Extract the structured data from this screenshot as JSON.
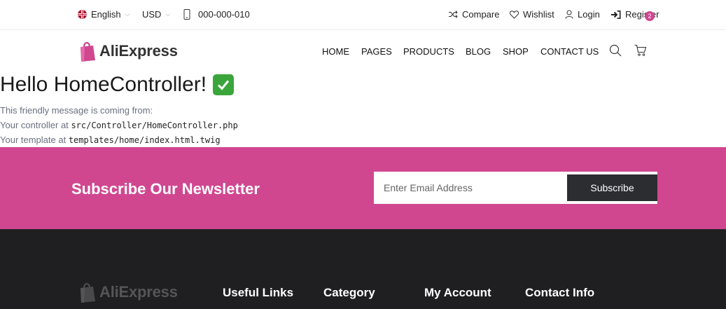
{
  "topbar": {
    "language": "English",
    "currency": "USD",
    "phone": "000-000-010",
    "compare": "Compare",
    "wishlist": "Wishlist",
    "login": "Login",
    "register": "Register"
  },
  "header": {
    "logo": "AliExpress",
    "nav": [
      "HOME",
      "PAGES",
      "PRODUCTS",
      "BLOG",
      "SHOP",
      "CONTACT US"
    ],
    "cart_count": "2"
  },
  "content": {
    "title": "Hello HomeController!",
    "line1": "This friendly message is coming from:",
    "line2_prefix": "Your controller at",
    "line2_code": "src/Controller/HomeController.php",
    "line3_prefix": "Your template at",
    "line3_code": "templates/home/index.html.twig"
  },
  "newsletter": {
    "title": "Subscribe Our Newsletter",
    "placeholder": "Enter Email Address",
    "button": "Subscribe"
  },
  "footer": {
    "logo": "AliExpress",
    "headings": [
      "Useful Links",
      "Category",
      "My Account",
      "Contact Info"
    ]
  },
  "colors": {
    "brand": "#d04790",
    "dark": "#1f1f22",
    "button": "#2c2d31"
  }
}
